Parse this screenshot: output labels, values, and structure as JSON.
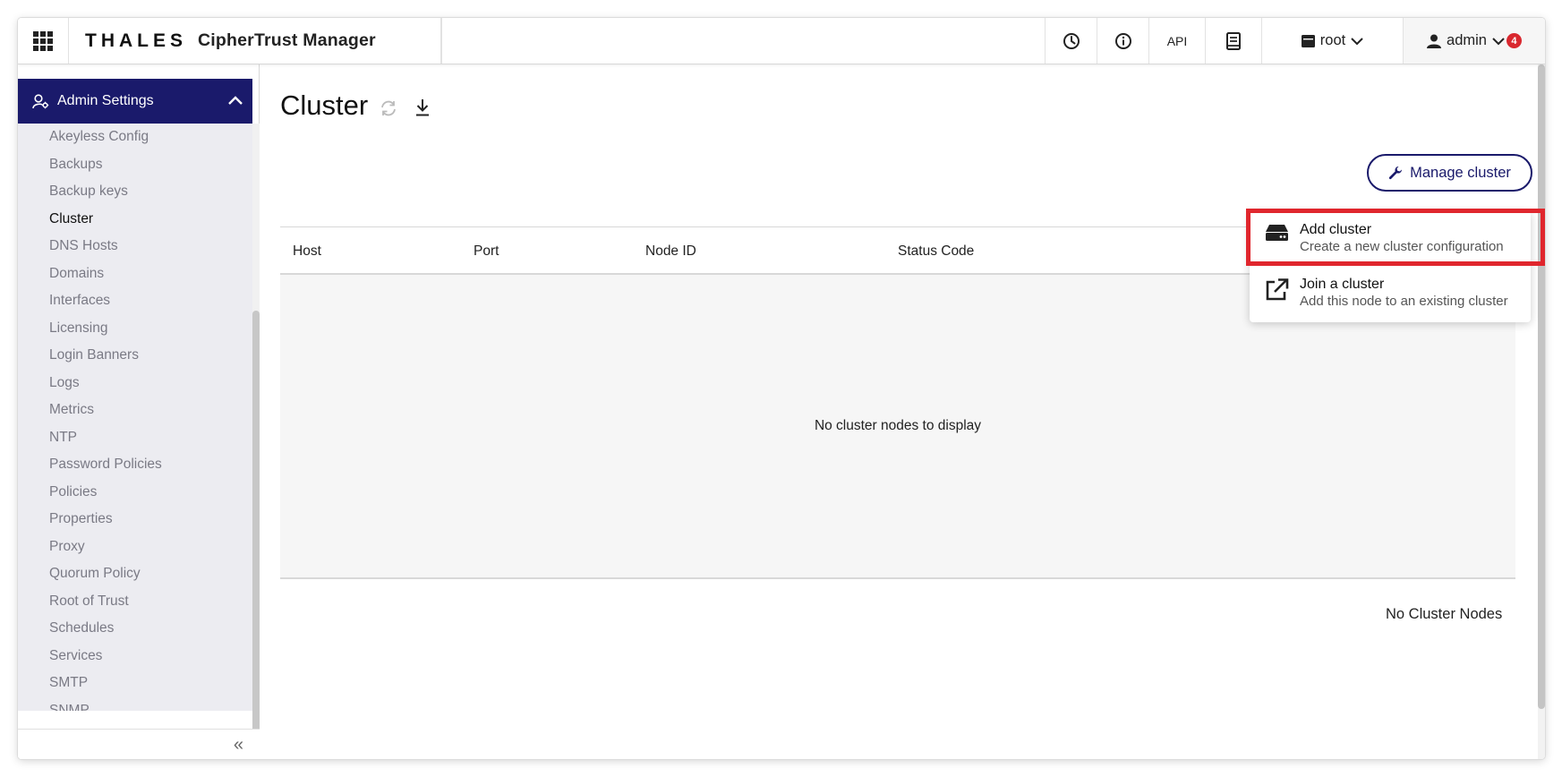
{
  "topbar": {
    "brand_thales": "THALES",
    "brand_product": "CipherTrust Manager",
    "api_label": "API",
    "domain_label": "root",
    "user_label": "admin",
    "notification_count": "4"
  },
  "sidebar": {
    "section_title": "Admin Settings",
    "items": [
      {
        "label": "Akeyless Config"
      },
      {
        "label": "Backups"
      },
      {
        "label": "Backup keys"
      },
      {
        "label": "Cluster"
      },
      {
        "label": "DNS Hosts"
      },
      {
        "label": "Domains"
      },
      {
        "label": "Interfaces"
      },
      {
        "label": "Licensing"
      },
      {
        "label": "Login Banners"
      },
      {
        "label": "Logs"
      },
      {
        "label": "Metrics"
      },
      {
        "label": "NTP"
      },
      {
        "label": "Password Policies"
      },
      {
        "label": "Policies"
      },
      {
        "label": "Properties"
      },
      {
        "label": "Proxy"
      },
      {
        "label": "Quorum Policy"
      },
      {
        "label": "Root of Trust"
      },
      {
        "label": "Schedules"
      },
      {
        "label": "Services"
      },
      {
        "label": "SMTP"
      },
      {
        "label": "SNMP"
      }
    ],
    "active_item": "Cluster",
    "collapse_glyph": "«"
  },
  "main": {
    "title": "Cluster",
    "manage_button": "Manage cluster",
    "table": {
      "columns": [
        "Host",
        "Port",
        "Node ID",
        "Status Code"
      ],
      "empty_message": "No cluster nodes to display"
    },
    "footer_count": "No Cluster Nodes"
  },
  "menu": {
    "items": [
      {
        "title": "Add cluster",
        "subtitle": "Create a new cluster configuration",
        "icon": "hard-drive-icon"
      },
      {
        "title": "Join a cluster",
        "subtitle": "Add this node to an existing cluster",
        "icon": "external-link-icon"
      }
    ],
    "highlighted": "Add cluster"
  },
  "colors": {
    "brand_navy": "#1a1a6b",
    "highlight_red": "#e0262d",
    "badge_red": "#d9282f",
    "sidebar_bg": "#ececf1"
  }
}
